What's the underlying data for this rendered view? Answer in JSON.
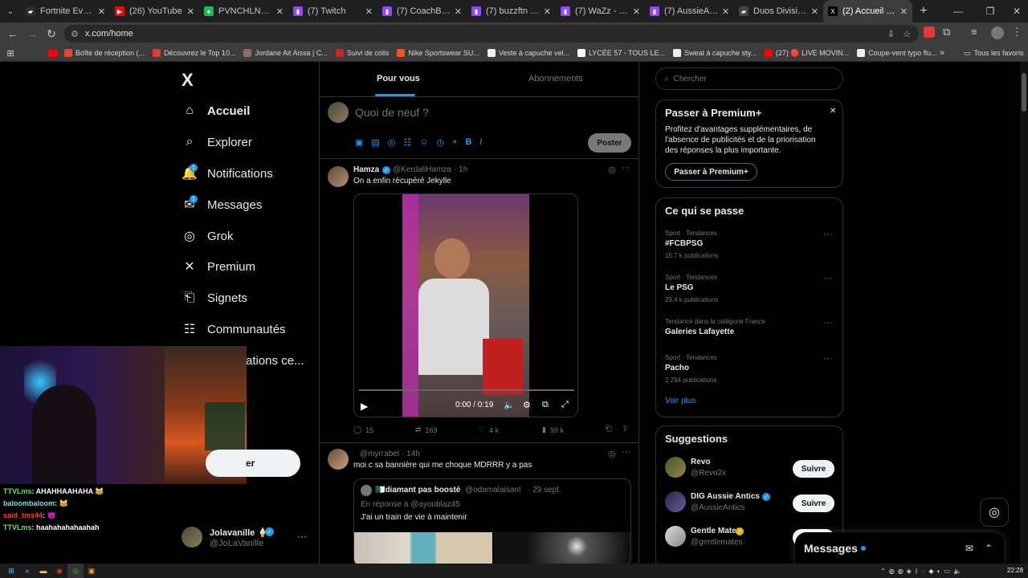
{
  "browser": {
    "tabs": [
      {
        "label": "Fortnite Events - E",
        "color": "#2e2e2e",
        "glyph": "▰"
      },
      {
        "label": "(26) YouTube",
        "color": "#ff0000",
        "glyph": "▶"
      },
      {
        "label": "PVNCHLNRS | Sp",
        "color": "#1db954",
        "glyph": "●"
      },
      {
        "label": "(7) Twitch",
        "color": "#9146ff",
        "glyph": "▮"
      },
      {
        "label": "(7) CoachBoop - T",
        "color": "#9146ff",
        "glyph": "▮"
      },
      {
        "label": "(7) buzzftn - Twit",
        "color": "#9146ff",
        "glyph": "▮"
      },
      {
        "label": "(7) WaZz - Twitch",
        "color": "#9146ff",
        "glyph": "▮"
      },
      {
        "label": "(7) AussieAntics",
        "color": "#9146ff",
        "glyph": "▮"
      },
      {
        "label": "Duos Division 1 a",
        "color": "#444444",
        "glyph": "▰"
      },
      {
        "label": "(2) Accueil / X",
        "color": "#000000",
        "glyph": "X"
      }
    ],
    "url": "x.com/home",
    "bookmarks": [
      {
        "label": "Boîte de réception (...",
        "color": "#ea4335"
      },
      {
        "label": "Découvrez le Top 10...",
        "color": "#e53935"
      },
      {
        "label": "Jordane Ait Aissa | C...",
        "color": "#8d6e63"
      },
      {
        "label": "Suivi de colis",
        "color": "#c62828"
      },
      {
        "label": "Nike Sportswear SU...",
        "color": "#f4511e"
      },
      {
        "label": "Veste à capuche vel...",
        "color": "#eeeeee"
      },
      {
        "label": "LYCÉE 57 - TOUS LE...",
        "color": "#fafafa"
      },
      {
        "label": "Sweat à capuche sty...",
        "color": "#eeeeee"
      },
      {
        "label": "(27) 🔴 LIVE MOVIN...",
        "color": "#ff0000"
      },
      {
        "label": "Coupe-vent typo flu...",
        "color": "#eeeeee"
      }
    ],
    "all_bookmarks": "Tous les favoris"
  },
  "nav": {
    "logo": "X",
    "items": [
      {
        "label": "Accueil",
        "icon": "home-icon"
      },
      {
        "label": "Explorer",
        "icon": "search-icon"
      },
      {
        "label": "Notifications",
        "icon": "bell-icon",
        "badge": "1"
      },
      {
        "label": "Messages",
        "icon": "mail-icon",
        "badge": "1"
      },
      {
        "label": "Grok",
        "icon": "grok-icon"
      },
      {
        "label": "Premium",
        "icon": "x-icon"
      },
      {
        "label": "Signets",
        "icon": "bookmark-icon"
      },
      {
        "label": "Communautés",
        "icon": "people-icon"
      },
      {
        "label": "ations ce...",
        "icon": ""
      }
    ],
    "post_button_partial": "er",
    "profile": {
      "name": "Jolavanille 🍦",
      "handle": "@JoLaVanille",
      "more": "···"
    }
  },
  "stream_overlay": {
    "chat": [
      {
        "user": "TTVLms",
        "user_color": "#5ee65e",
        "text": ": AHAHHAAHAHA 😹"
      },
      {
        "user": "baloombaloom",
        "user_color": "#5ee6e6",
        "text": ": 😹"
      },
      {
        "user": "said_tms44",
        "user_color": "#ff3b3b",
        "text": ": 😈"
      },
      {
        "user": "TTVLms",
        "user_color": "#5ee65e",
        "text": ": haahahahahaahah"
      }
    ]
  },
  "feed": {
    "tabs": [
      "Pour vous",
      "Abonnements"
    ],
    "compose": {
      "placeholder": "Quoi de neuf ?",
      "post_button": "Poster"
    },
    "tweets": [
      {
        "name": "Hamza",
        "verified": true,
        "handle": "@KerdaliHamza",
        "time": "· 1h",
        "text": "On a enfin récupéré Jekylle",
        "video": {
          "time": "0:00 / 0:19"
        },
        "stats": {
          "replies": "15",
          "retweets": "169",
          "likes": "4 k",
          "views": "99 k"
        }
      },
      {
        "name": "",
        "handle": "@myrrabel",
        "time": "· 14h",
        "text": "moi c sa bannière qui me choque MDRRR y a pas",
        "quote": {
          "name": "🇩🇿diamant pas boosté",
          "handle": "@odamalaisant",
          "time": "· 29 sept.",
          "reply_to": "En réponse à @ayoublaz45",
          "text": "J'ai un train de vie à maintenir"
        }
      }
    ]
  },
  "sidebar": {
    "search_placeholder": "Chercher",
    "premium": {
      "title": "Passer à Premium+",
      "text_lines": [
        "Profitez d'avantages supplémentaires, de",
        "l'absence de publicités et de la priorisation",
        "des réponses la plus importante."
      ],
      "button": "Passer à Premium+"
    },
    "trends": {
      "title": "Ce qui se passe",
      "items": [
        {
          "context": "Sport · Tendances",
          "name": "#FCBPSG",
          "count": "15,7 k publications"
        },
        {
          "context": "Sport · Tendances",
          "name": "Le PSG",
          "count": "29,4 k publications"
        },
        {
          "context": "Tendance dans la catégorie France",
          "name": "Galeries Lafayette",
          "count": ""
        },
        {
          "context": "Sport · Tendances",
          "name": "Pacho",
          "count": "2 294 publications"
        }
      ],
      "more": "Voir plus"
    },
    "suggestions": {
      "title": "Suggestions",
      "items": [
        {
          "name": "Revo",
          "handle": "@Revo2x",
          "verified": "",
          "button": "Suivre"
        },
        {
          "name": "DIG Aussie Antics",
          "handle": "@AussieAntics",
          "verified": "blue",
          "button": "Suivre"
        },
        {
          "name": "Gentle Mates",
          "handle": "@gentlemates",
          "verified": "gold",
          "button": ""
        }
      ]
    },
    "messages_drawer": "Messages"
  },
  "taskbar": {
    "time": "22:28"
  },
  "colors": {
    "accent": "#1d9bf0",
    "muted": "#71767b",
    "border": "#2f3336"
  }
}
